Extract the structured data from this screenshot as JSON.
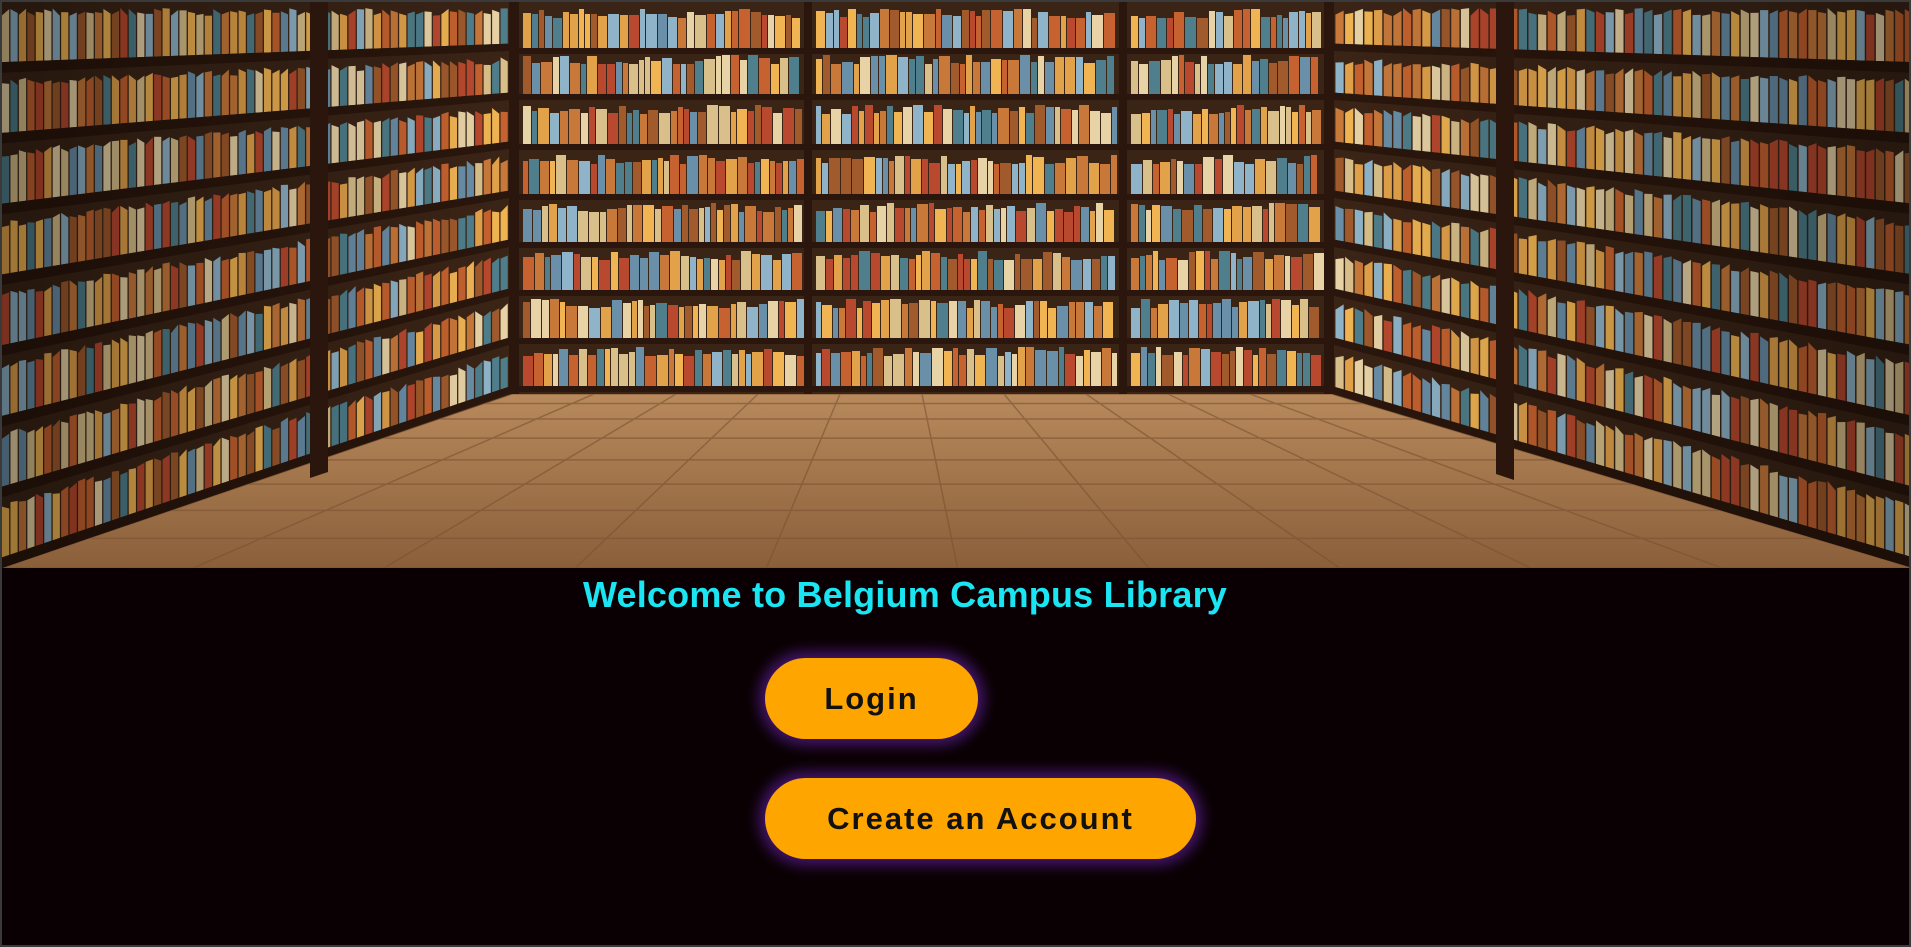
{
  "hero": {
    "scene": "library bookshelves and wooden floor"
  },
  "page": {
    "title": "Welcome to Belgium Campus Library"
  },
  "actions": {
    "login_label": "Login",
    "create_account_label": "Create an Account"
  },
  "colors": {
    "background": "#0a0003",
    "title": "#19e6f2",
    "button": "#ffa500",
    "button_glow": "#7828c8"
  }
}
